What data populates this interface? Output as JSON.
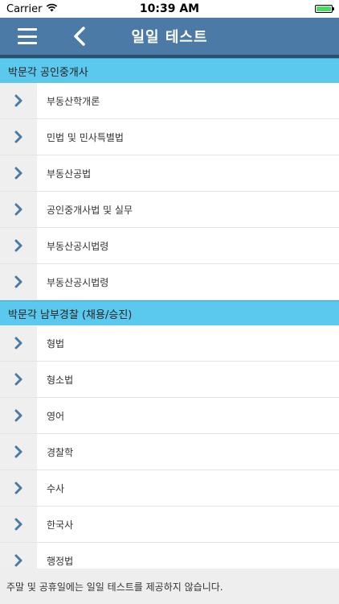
{
  "status_bar": {
    "carrier": "Carrier",
    "time": "10:39 AM",
    "wifi_icon": "wifi-icon",
    "battery_icon": "battery-full-icon",
    "battery_color": "#4cd964"
  },
  "nav": {
    "title": "일일 테스트",
    "menu_icon": "hamburger-menu-icon",
    "back_icon": "chevron-left-icon",
    "background_color": "#4a7aa5"
  },
  "sections": [
    {
      "title": "박문각 공인중개사",
      "items": [
        {
          "label": "부동산학개론"
        },
        {
          "label": "민법 및 민사특별법"
        },
        {
          "label": "부동산공법"
        },
        {
          "label": "공인중개사법 및 실무"
        },
        {
          "label": "부동산공시법령"
        },
        {
          "label": "부동산공시법령"
        }
      ]
    },
    {
      "title": "박문각 남부경찰 (채용/승진)",
      "items": [
        {
          "label": "형법"
        },
        {
          "label": "형소법"
        },
        {
          "label": "영어"
        },
        {
          "label": "경찰학"
        },
        {
          "label": "수사"
        },
        {
          "label": "한국사"
        },
        {
          "label": "행정법"
        }
      ]
    }
  ],
  "colors": {
    "section_header": "#5bc8ee",
    "chevron": "#4a7aa5"
  },
  "footer": {
    "notice": "주말 및 공휴일에는 일일 테스트를 제공하지 않습니다."
  }
}
